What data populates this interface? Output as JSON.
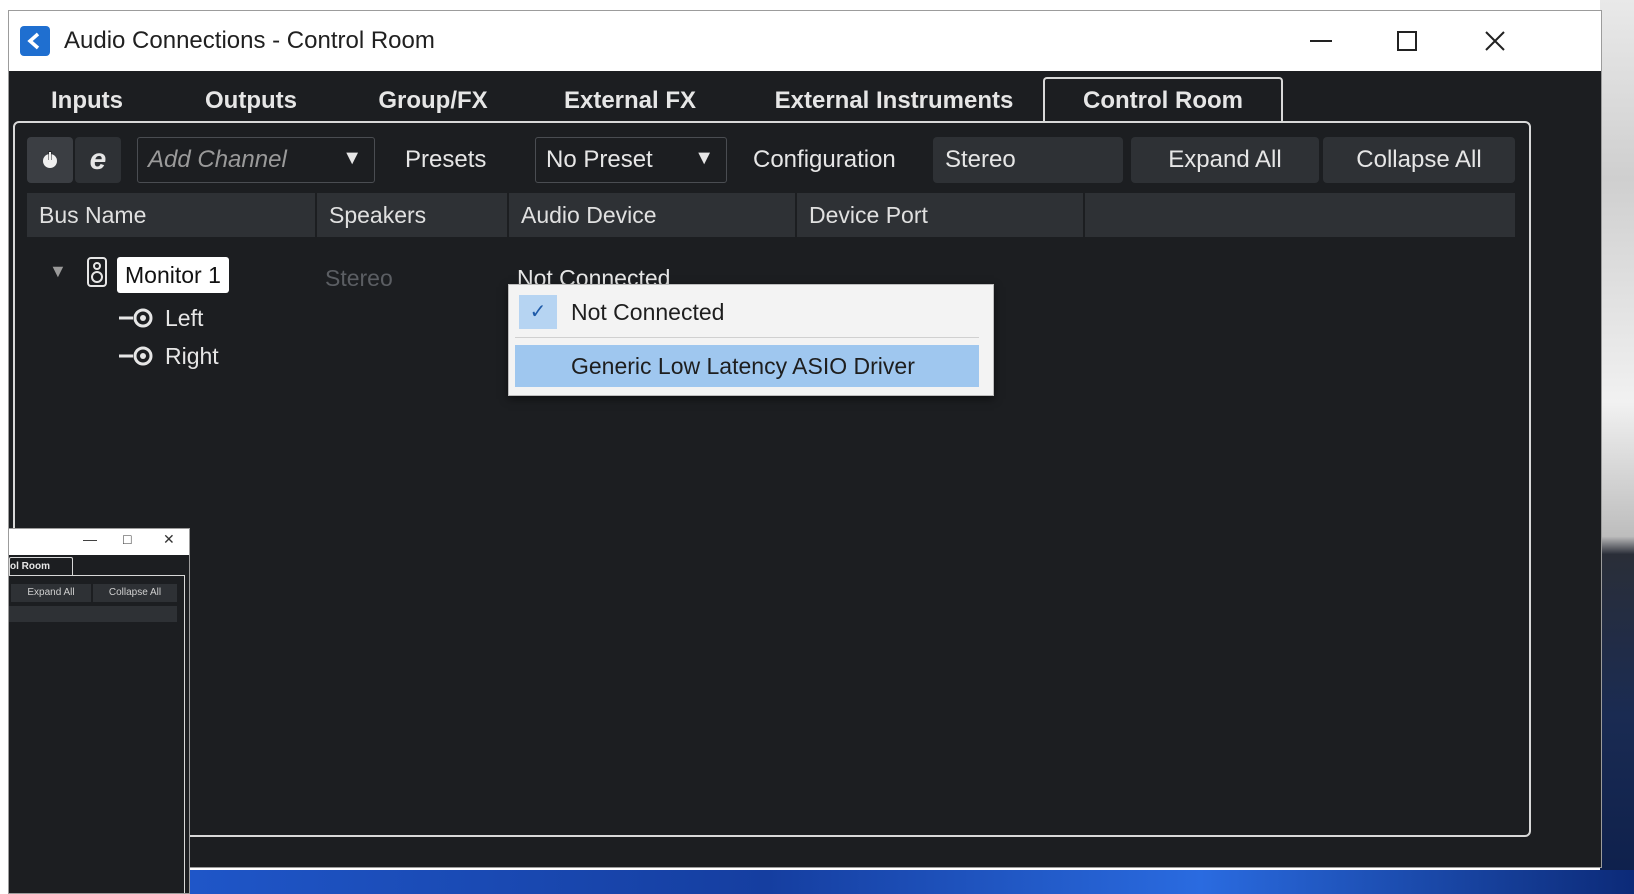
{
  "window": {
    "title": "Audio Connections - Control Room",
    "controls": {
      "minimize": "—",
      "maximize": "☐",
      "close": "✕"
    }
  },
  "tabs": [
    {
      "label": "Inputs",
      "active": false
    },
    {
      "label": "Outputs",
      "active": false
    },
    {
      "label": "Group/FX",
      "active": false
    },
    {
      "label": "External FX",
      "active": false
    },
    {
      "label": "External Instruments",
      "active": false
    },
    {
      "label": "Control Room",
      "active": true
    }
  ],
  "toolbar": {
    "power_icon": "power-icon",
    "edit_icon": "e",
    "add_channel": {
      "placeholder": "Add Channel",
      "caret": "▼"
    },
    "presets_label": "Presets",
    "preset_value": "No Preset",
    "preset_caret": "▼",
    "configuration_label": "Configuration",
    "configuration_value": "Stereo",
    "expand_all": "Expand All",
    "collapse_all": "Collapse All"
  },
  "columns": [
    "Bus Name",
    "Speakers",
    "Audio Device",
    "Device Port"
  ],
  "bus": {
    "expand_caret": "▼",
    "name": "Monitor 1",
    "speakers": "Stereo",
    "audio_device": "Not Connected",
    "channels": [
      "Left",
      "Right"
    ]
  },
  "device_menu": {
    "items": [
      {
        "label": "Not Connected",
        "checked": true,
        "check_mark": "✓"
      },
      {
        "label": "Generic Low Latency ASIO Driver",
        "highlighted": true
      }
    ]
  },
  "mini_window": {
    "controls": {
      "minimize": "—",
      "maximize": "□",
      "close": "✕"
    },
    "tab_label": "ol Room",
    "expand_all": "Expand All",
    "collapse_all": "Collapse All"
  },
  "colors": {
    "window_bg": "#1c1e21",
    "header_bg": "#2e3135",
    "menu_highlight": "#9fc7ef",
    "check_bg": "#b6d4f2",
    "app_icon": "#1f6fd0"
  }
}
